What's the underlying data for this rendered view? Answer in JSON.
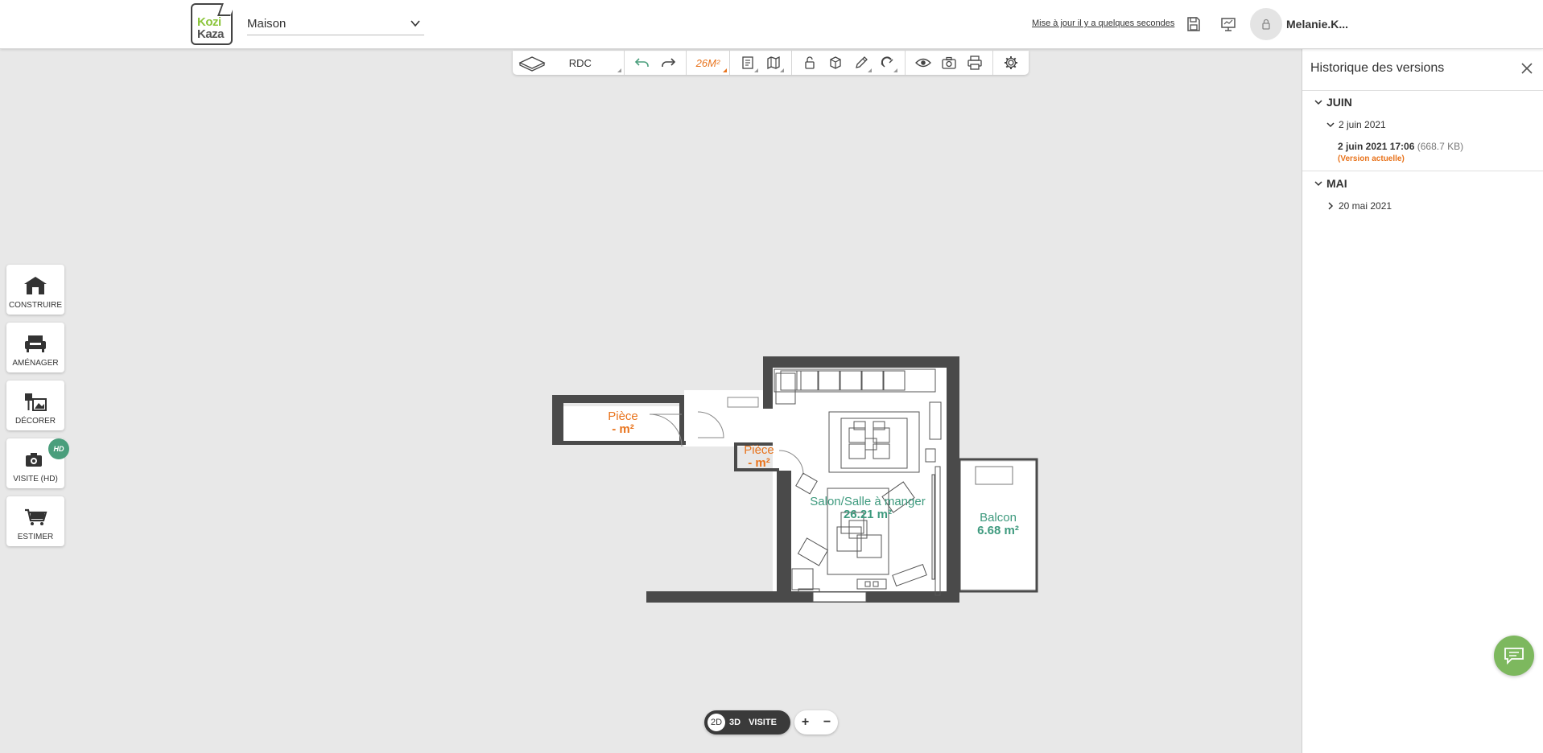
{
  "header": {
    "logo_line1": "Kozi",
    "logo_line2": "Kaza",
    "project_name": "Maison",
    "last_saved": "Mise à jour il y a quelques secondes",
    "user_name": "Melanie.K..."
  },
  "toolbar": {
    "level": "RDC",
    "surface": "26M²"
  },
  "tools": [
    {
      "label": "CONSTRUIRE"
    },
    {
      "label": "AMÉNAGER"
    },
    {
      "label": "DÉCORER"
    },
    {
      "label": "VISITE (HD)",
      "badge": "HD"
    },
    {
      "label": "ESTIMER"
    }
  ],
  "plan": {
    "rooms": [
      {
        "name": "Pièce",
        "area": "- m²"
      },
      {
        "name": "Pièce",
        "area": "- m²"
      },
      {
        "name": "Salon/Salle à manger",
        "area": "26.21 m²"
      },
      {
        "name": "Balcon",
        "area": "6.68 m²"
      }
    ]
  },
  "view": {
    "options": [
      "2D",
      "3D",
      "VISITE"
    ],
    "active": "2D",
    "zoom_in": "+",
    "zoom_out": "−"
  },
  "history": {
    "title": "Historique des versions",
    "months": [
      {
        "name": "JUIN",
        "days": [
          {
            "label": "2 juin 2021",
            "versions": [
              {
                "datetime": "2 juin 2021 17:06",
                "size": "(668.7 KB)",
                "current_label": "(Version actuelle)"
              }
            ]
          }
        ]
      },
      {
        "name": "MAI",
        "days": [
          {
            "label": "20 mai 2021"
          }
        ]
      }
    ]
  },
  "colors": {
    "accent_green": "#8dc63f",
    "orange": "#e8731c",
    "teal": "#3e9a7e",
    "chat_green": "#7db85e",
    "wall": "#4a4a4a"
  }
}
